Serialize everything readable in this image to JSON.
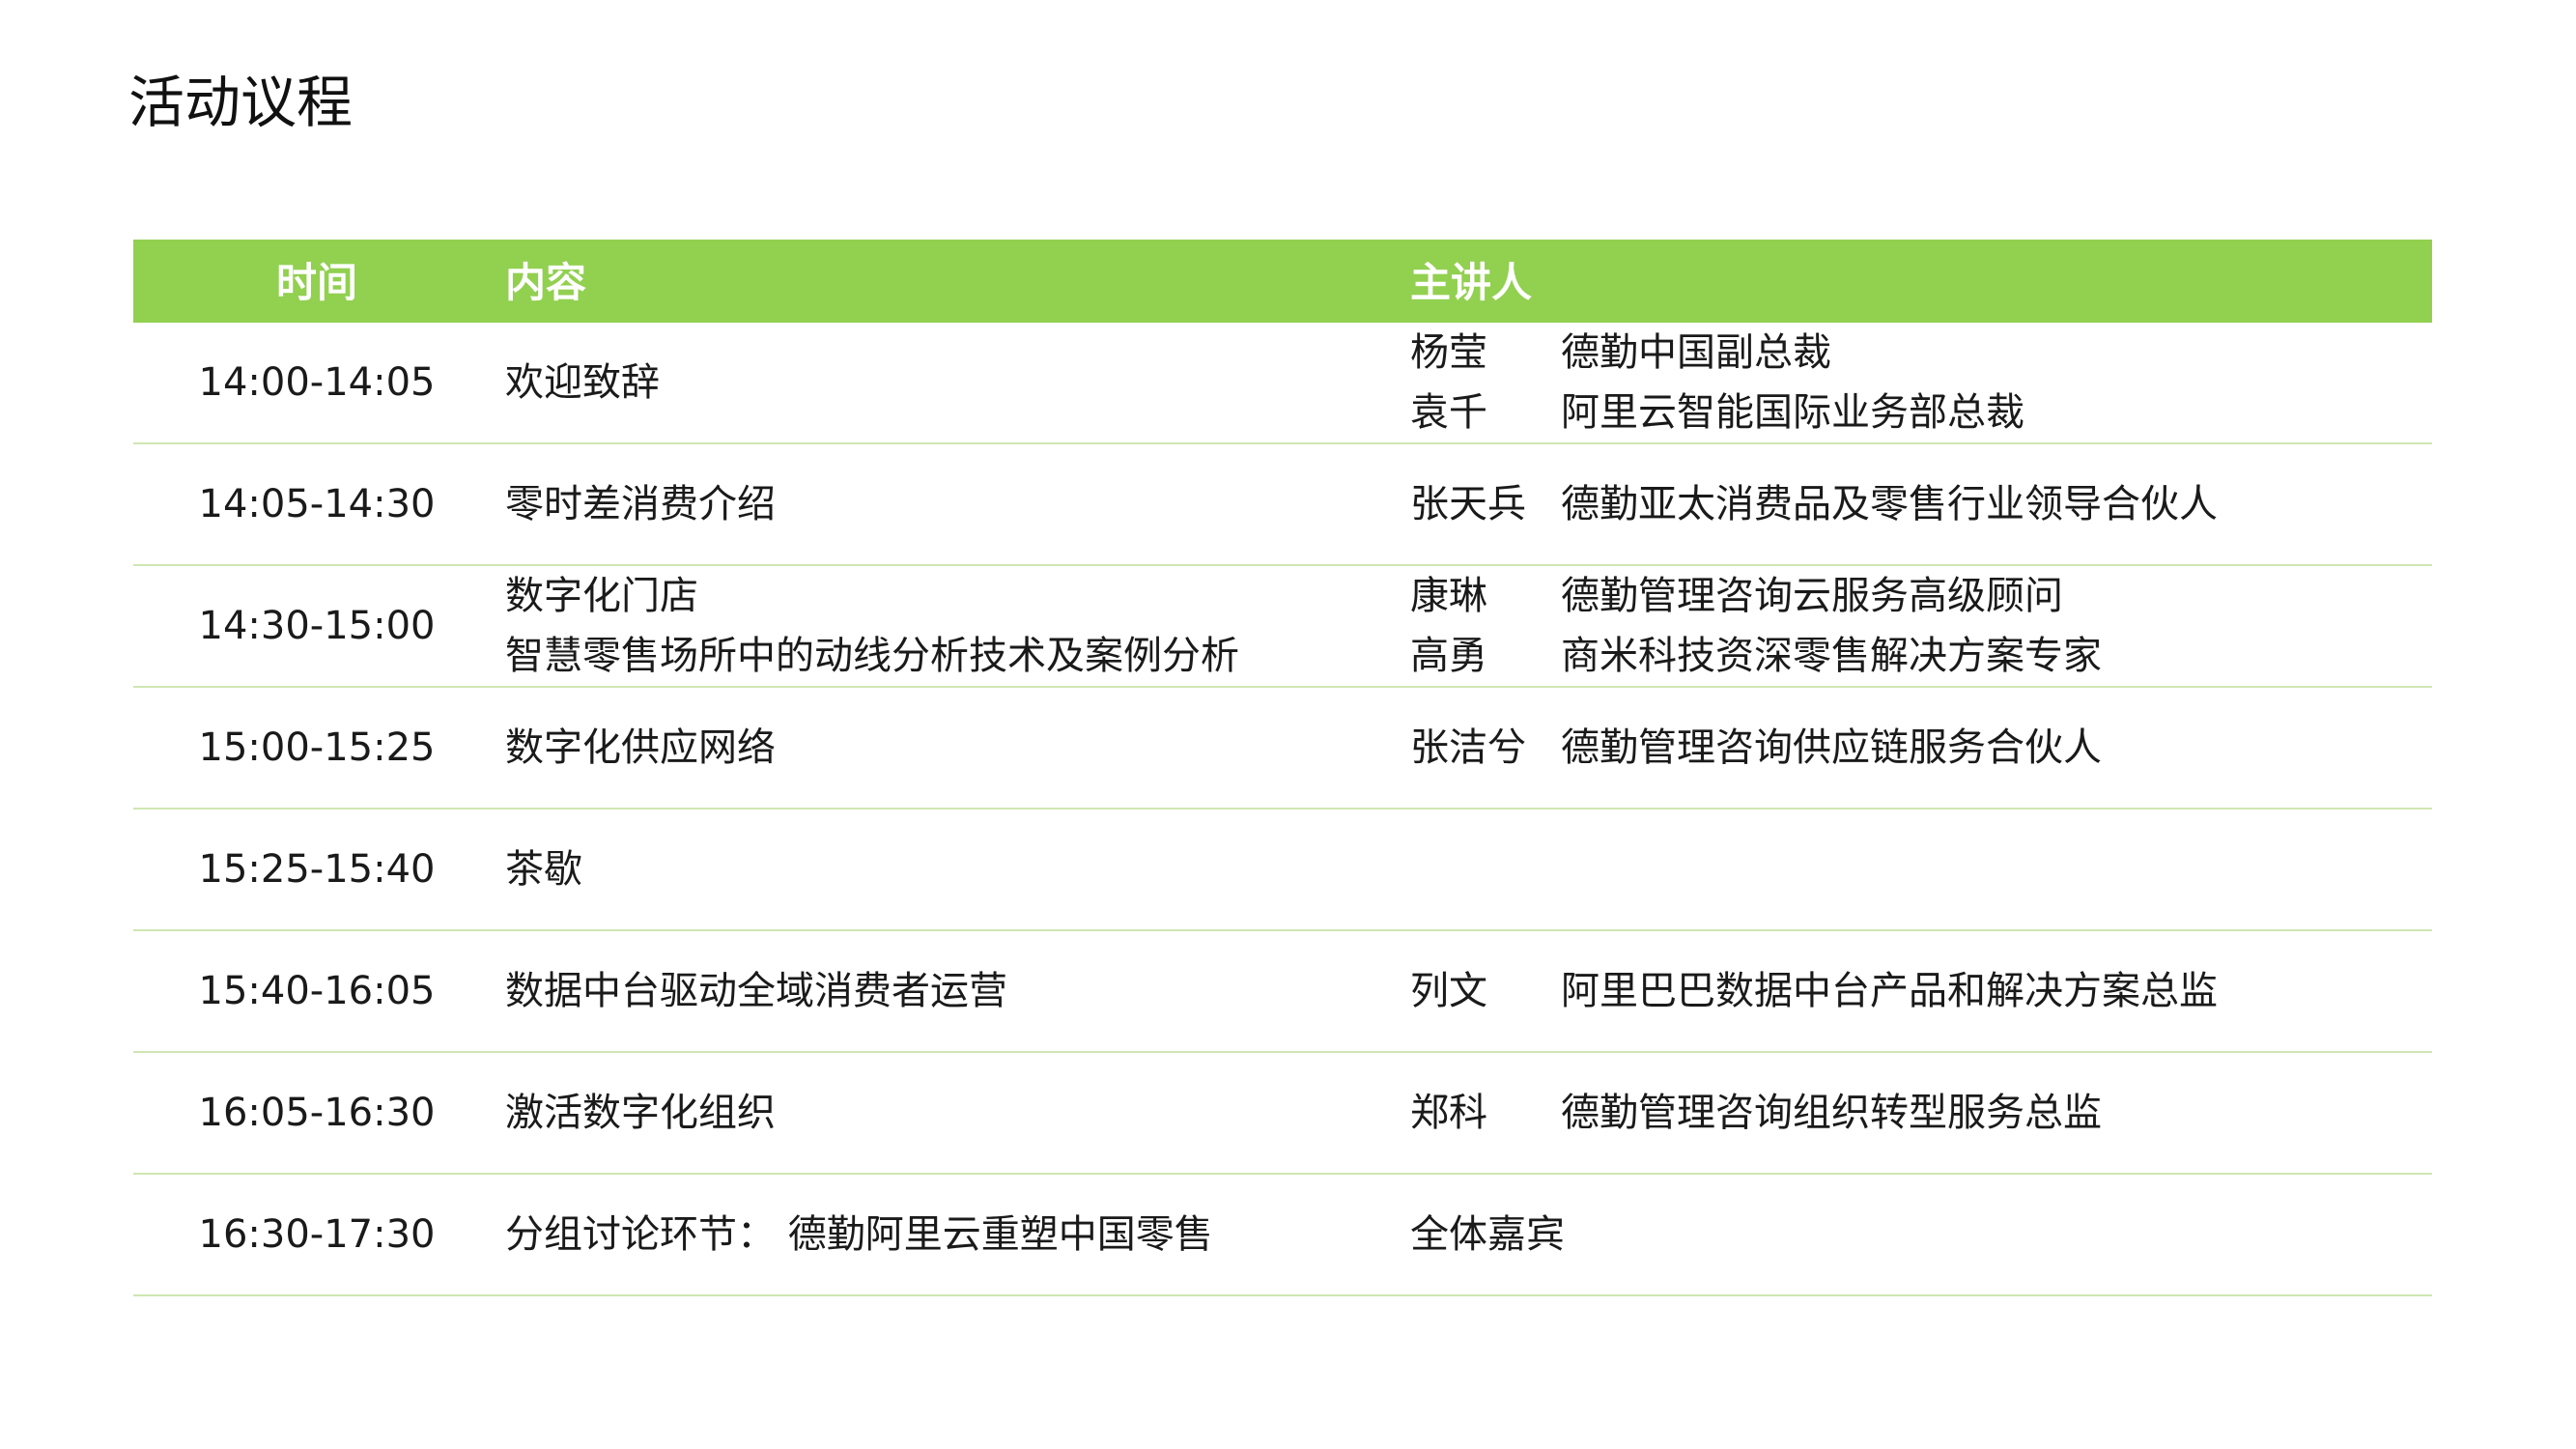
{
  "page": {
    "title": "活动议程"
  },
  "table": {
    "headers": {
      "time": "时间",
      "content": "内容",
      "speaker": "主讲人"
    },
    "rows": [
      {
        "time": "14:00-14:05",
        "content": [
          "欢迎致辞"
        ],
        "speakers": [
          {
            "name": "杨莹",
            "title": "德勤中国副总裁"
          },
          {
            "name": "袁千",
            "title": "阿里云智能国际业务部总裁"
          }
        ]
      },
      {
        "time": "14:05-14:30",
        "content": [
          "零时差消费介绍"
        ],
        "speakers": [
          {
            "name": "张天兵",
            "title": "德勤亚太消费品及零售行业领导合伙人"
          }
        ]
      },
      {
        "time": "14:30-15:00",
        "content": [
          "数字化门店",
          "智慧零售场所中的动线分析技术及案例分析"
        ],
        "speakers": [
          {
            "name": "康琳",
            "title": "德勤管理咨询云服务高级顾问"
          },
          {
            "name": "高勇",
            "title": "商米科技资深零售解决方案专家"
          }
        ]
      },
      {
        "time": "15:00-15:25",
        "content": [
          "数字化供应网络"
        ],
        "speakers": [
          {
            "name": "张洁兮",
            "title": "德勤管理咨询供应链服务合伙人"
          }
        ]
      },
      {
        "time": "15:25-15:40",
        "content": [
          "茶歇"
        ],
        "speakers": []
      },
      {
        "time": "15:40-16:05",
        "content": [
          "数据中台驱动全域消费者运营"
        ],
        "speakers": [
          {
            "name": "列文",
            "title": "阿里巴巴数据中台产品和解决方案总监"
          }
        ]
      },
      {
        "time": "16:05-16:30",
        "content": [
          "激活数字化组织"
        ],
        "speakers": [
          {
            "name": "郑科",
            "title": "德勤管理咨询组织转型服务总监"
          }
        ]
      },
      {
        "time": "16:30-17:30",
        "content": [
          "分组讨论环节： 德勤阿里云重塑中国零售"
        ],
        "speakers": [
          {
            "name": "全体嘉宾",
            "title": ""
          }
        ]
      }
    ]
  },
  "colors": {
    "header_background": "#92d050",
    "header_text": "#ffffff",
    "row_divider": "#cfe6b3"
  }
}
